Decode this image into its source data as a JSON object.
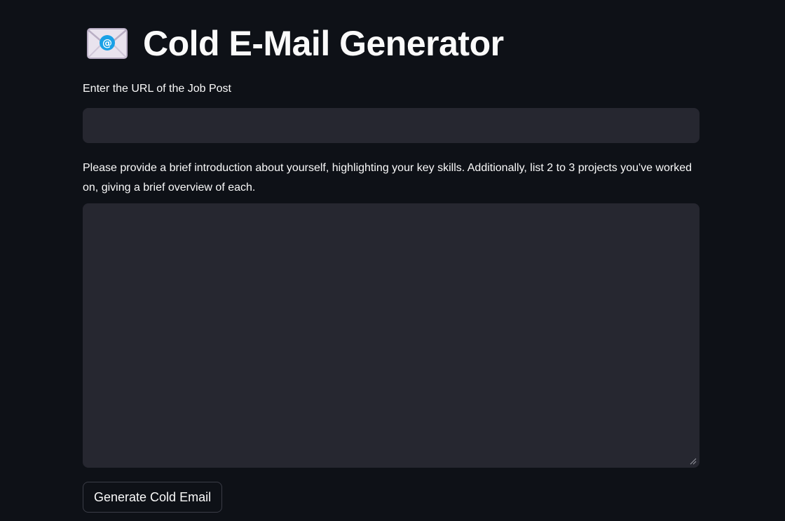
{
  "header": {
    "icon": "envelope-with-at-sign-icon",
    "title": "Cold E-Mail Generator"
  },
  "url_field": {
    "label": "Enter the URL of the Job Post",
    "value": "",
    "placeholder": ""
  },
  "intro_field": {
    "label": "Please provide a brief introduction about yourself, highlighting your key skills. Additionally, list 2 to 3 projects you've worked on, giving a brief overview of each.",
    "value": "",
    "placeholder": ""
  },
  "actions": {
    "generate_label": "Generate Cold Email"
  },
  "colors": {
    "background": "#0e1117",
    "input_background": "#262730",
    "text": "#fafafa",
    "button_border": "#3b3d47",
    "icon_accent": "#1aa1e6"
  }
}
